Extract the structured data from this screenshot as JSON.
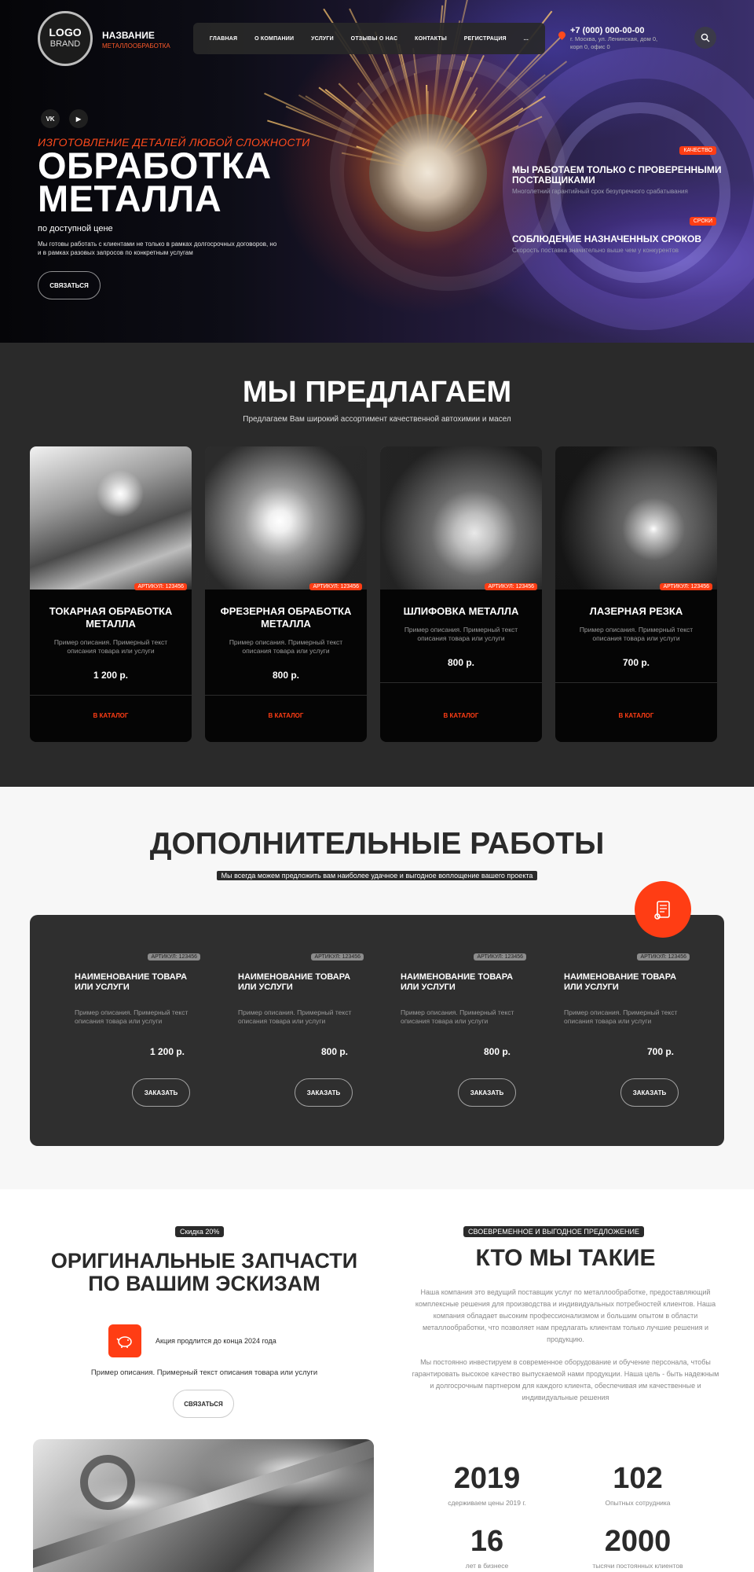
{
  "header": {
    "logo_line1": "LOGO",
    "logo_line2": "BRAND",
    "brand_name": "НАЗВАНИЕ",
    "brand_sub": "МЕТАЛЛООБРАБОТКА",
    "nav": [
      "ГЛАВНАЯ",
      "О КОМПАНИИ",
      "УСЛУГИ",
      "ОТЗЫВЫ О НАС",
      "КОНТАКТЫ",
      "РЕГИСТРАЦИЯ",
      "..."
    ],
    "phone": "+7 (000) 000-00-00",
    "address": "г. Москва, ул. Ленинская, дом 0, корп 0, офис 0",
    "icons": [
      "search-icon",
      "location-pin-icon",
      "vk-icon",
      "youtube-icon"
    ]
  },
  "hero": {
    "social": [
      "VK",
      "▶"
    ],
    "subtitle": "ИЗГОТОВЛЕНИЕ ДЕТАЛЕЙ ЛЮБОЙ СЛОЖНОСТИ",
    "title_line1": "ОБРАБОТКА",
    "title_line2": "МЕТАЛЛА",
    "price_line": "по доступной цене",
    "description": "Мы готовы работать с клиентами не только в рамках долгосрочных договоров, но и в рамках разовых запросов по конкретным услугам",
    "cta": "СВЯЗАТЬСЯ",
    "features": [
      {
        "badge": "КАЧЕСТВО",
        "title": "МЫ РАБОТАЕМ ТОЛЬКО С ПРОВЕРЕННЫМИ ПОСТАВЩИКАМИ",
        "text": "Многолетний гарантийный срок безупречного срабатывания"
      },
      {
        "badge": "СРОКИ",
        "title": "СОБЛЮДЕНИЕ НАЗНАЧЕННЫХ СРОКОВ",
        "text": "Скорость поставка значительно выше чем у конкурентов"
      }
    ]
  },
  "offer": {
    "title": "МЫ ПРЕДЛАГАЕМ",
    "subtitle": "Предлагаем Вам широкий ассортимент качественной автохимии и масел",
    "cards": [
      {
        "article": "АРТИКУЛ: 123456",
        "title": "ТОКАРНАЯ ОБРАБОТКА МЕТАЛЛА",
        "text": "Пример описания. Примерный текст описания товара или услуги",
        "price": "1 200 р.",
        "link": "В КАТАЛОГ"
      },
      {
        "article": "АРТИКУЛ: 123456",
        "title": "ФРЕЗЕРНАЯ ОБРАБОТКА МЕТАЛЛА",
        "text": "Пример описания. Примерный текст описания товара или услуги",
        "price": "800 р.",
        "link": "В КАТАЛОГ"
      },
      {
        "article": "АРТИКУЛ: 123456",
        "title": "ШЛИФОВКА МЕТАЛЛА",
        "text": "Пример описания. Примерный текст описания товара или услуги",
        "price": "800 р.",
        "link": "В КАТАЛОГ"
      },
      {
        "article": "АРТИКУЛ: 123456",
        "title": "ЛАЗЕРНАЯ РЕЗКА",
        "text": "Пример описания. Примерный текст описания товара или услуги",
        "price": "700 р.",
        "link": "В КАТАЛОГ"
      }
    ]
  },
  "extra": {
    "title": "ДОПОЛНИТЕЛЬНЫЕ РАБОТЫ",
    "subtitle": "Мы всегда можем предложить вам наиболее удачное и выгодное воплощение вашего проекта",
    "items": [
      {
        "article": "АРТИКУЛ: 123456",
        "title": "НАИМЕНОВАНИЕ ТОВАРА ИЛИ УСЛУГИ",
        "text": "Пример описания. Примерный текст описания товара или услуги",
        "price": "1 200 р.",
        "button": "ЗАКАЗАТЬ"
      },
      {
        "article": "АРТИКУЛ: 123456",
        "title": "НАИМЕНОВАНИЕ ТОВАРА ИЛИ УСЛУГИ",
        "text": "Пример описания. Примерный текст описания товара или услуги",
        "price": "800 р.",
        "button": "ЗАКАЗАТЬ"
      },
      {
        "article": "АРТИКУЛ: 123456",
        "title": "НАИМЕНОВАНИЕ ТОВАРА ИЛИ УСЛУГИ",
        "text": "Пример описания. Примерный текст описания товара или услуги",
        "price": "800 р.",
        "button": "ЗАКАЗАТЬ"
      },
      {
        "article": "АРТИКУЛ: 123456",
        "title": "НАИМЕНОВАНИЕ ТОВАРА ИЛИ УСЛУГИ",
        "text": "Пример описания. Примерный текст описания товара или услуги",
        "price": "700 р.",
        "button": "ЗАКАЗАТЬ"
      }
    ]
  },
  "promo": {
    "tag": "Скидка 20%",
    "title": "ОРИГИНАЛЬНЫЕ ЗАПЧАСТИ ПО ВАШИМ ЭСКИЗАМ",
    "note": "Акция продлится до конца 2024 года",
    "text": "Пример описания. Примерный текст описания товара или услуги",
    "button": "СВЯЗАТЬСЯ"
  },
  "about": {
    "tag": "СВОЕВРЕМЕННОЕ И ВЫГОДНОЕ ПРЕДЛОЖЕНИЕ",
    "title": "КТО МЫ ТАКИЕ",
    "p1": "Наша компания это ведущий поставщик услуг по металлообработке, предоставляющий комплексные решения для производства и индивидуальных потребностей клиентов. Наша компания обладает высоким профессионализмом и большим опытом в области металлообработки, что позволяет нам предлагать клиентам только лучшие решения и продукцию.",
    "p2": "Мы постоянно инвестируем в современное оборудование и обучение персонала, чтобы гарантировать высокое качество выпускаемой нами продукции. Наша цель - быть надежным и долгосрочным партнером для каждого клиента, обеспечивая им качественные и индивидуальные решения",
    "stats": [
      {
        "value": "2019",
        "label": "сдерживаем цены 2019 г."
      },
      {
        "value": "102",
        "label": "Опытных сотрудника"
      },
      {
        "value": "16",
        "label": "лет в бизнесе"
      },
      {
        "value": "2000",
        "label": "тысячи постоянных клиентов"
      }
    ]
  },
  "colors": {
    "accent": "#ff3d14",
    "dark": "#2a2a2a",
    "light": "#f7f7f7"
  }
}
